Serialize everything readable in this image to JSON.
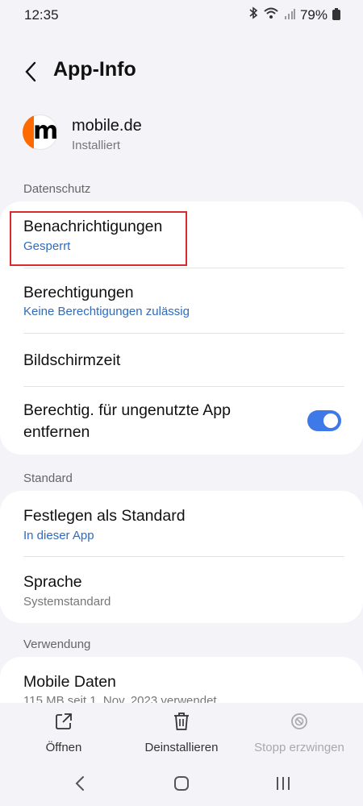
{
  "status_bar": {
    "time": "12:35",
    "battery_percent": "79%"
  },
  "header": {
    "title": "App-Info"
  },
  "app": {
    "name": "mobile.de",
    "status": "Installiert",
    "icon_letter": "m"
  },
  "sections": {
    "privacy": {
      "heading": "Datenschutz",
      "notifications": {
        "title": "Benachrichtigungen",
        "value": "Gesperrt"
      },
      "permissions": {
        "title": "Berechtigungen",
        "value": "Keine Berechtigungen zulässig"
      },
      "screen_time": {
        "title": "Bildschirmzeit"
      },
      "remove_permissions": {
        "title_line1": "Berechtig. für ungenutzte App",
        "title_line2": "entfernen",
        "enabled": true
      }
    },
    "default": {
      "heading": "Standard",
      "set_default": {
        "title": "Festlegen als Standard",
        "value": "In dieser App"
      },
      "language": {
        "title": "Sprache",
        "value": "Systemstandard"
      }
    },
    "usage": {
      "heading": "Verwendung",
      "mobile_data": {
        "title": "Mobile Daten",
        "value": "115 MB seit 1. Nov. 2023 verwendet"
      }
    }
  },
  "actions": {
    "open": "Öffnen",
    "uninstall": "Deinstallieren",
    "force_stop": "Stopp erzwingen"
  },
  "colors": {
    "accent": "#2f6bbd",
    "toggle": "#3f78e8",
    "highlight": "#d92b2b",
    "brand_orange": "#ff6a00"
  }
}
